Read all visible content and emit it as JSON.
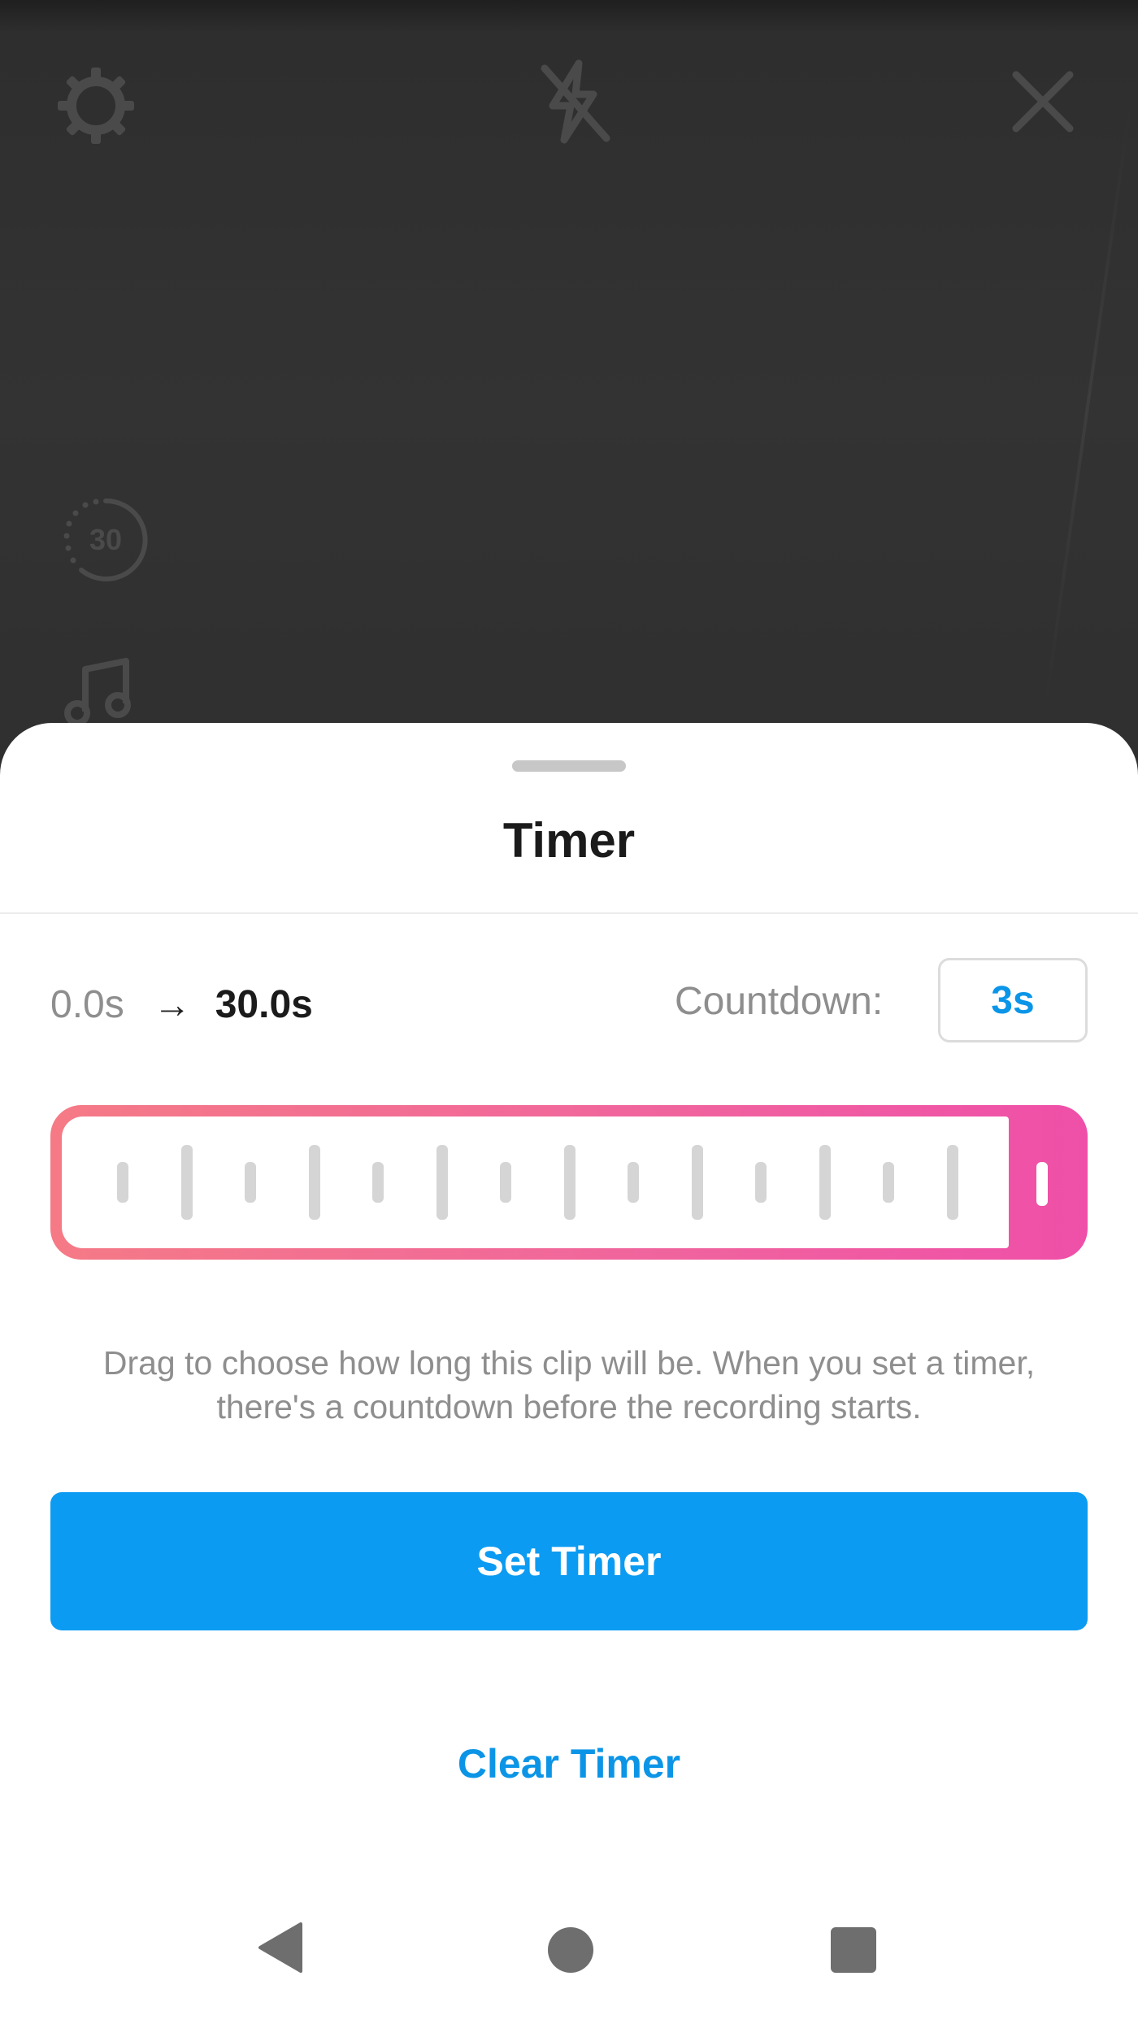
{
  "camera": {
    "duration_label": "30",
    "icons": [
      "gear-icon",
      "flash-off-icon",
      "close-icon",
      "duration-icon",
      "music-icon"
    ]
  },
  "sheet": {
    "title": "Timer",
    "range_start": "0.0s",
    "range_arrow": "→",
    "range_end": "30.0s",
    "countdown_label": "Countdown:",
    "countdown_value": "3s",
    "selected_fraction": 1.0,
    "helper_text": "Drag to choose how long this clip will be. When you set a timer, there's a countdown before the recording starts.",
    "set_button": "Set Timer",
    "clear_button": "Clear Timer"
  },
  "colors": {
    "accent_blue": "#0c9bf2",
    "gradient_start": "#f57a86",
    "gradient_end": "#ef4fa8"
  }
}
